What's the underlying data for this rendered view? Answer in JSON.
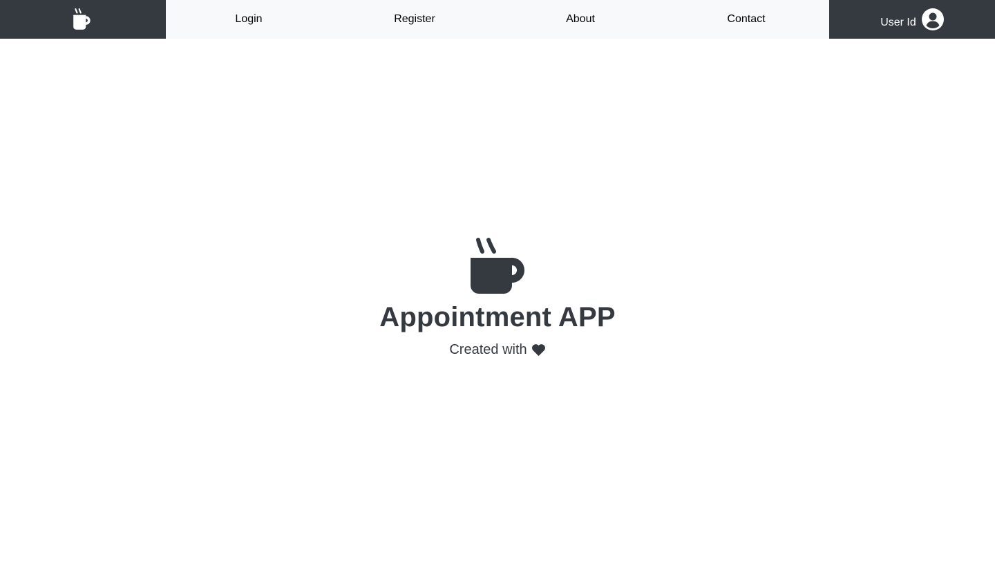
{
  "colors": {
    "dark": "#343a40",
    "light_nav": "#f8f9fa",
    "white": "#ffffff"
  },
  "navbar": {
    "brand_icon": "coffee-mug-icon",
    "links": [
      {
        "label": "Login"
      },
      {
        "label": "Register"
      },
      {
        "label": "About"
      },
      {
        "label": "Contact"
      }
    ],
    "user": {
      "label": "User Id",
      "icon": "user-circle-icon"
    }
  },
  "hero": {
    "icon": "coffee-mug-icon",
    "title": "Appointment APP",
    "subtitle": "Created with",
    "subtitle_icon": "heart-icon"
  }
}
